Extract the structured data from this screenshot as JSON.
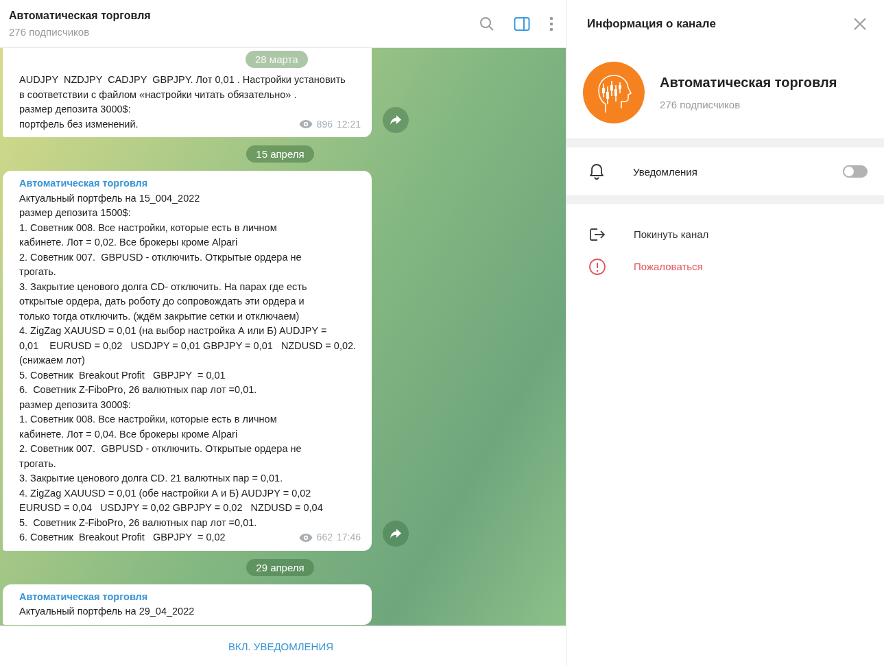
{
  "header": {
    "title": "Автоматическая торговля",
    "subtitle": "276 подписчиков",
    "actions": [
      {
        "kind": "search",
        "active": false
      },
      {
        "kind": "sidebar",
        "active": true
      },
      {
        "kind": "more",
        "active": false
      }
    ]
  },
  "chat": {
    "sticky_date": "28 марта",
    "items": [
      {
        "kind": "message",
        "lines": [
          "AUDJPY  NZDJPY  CADJPY  GBPJPY. Лот 0,01 . Настройки установить",
          "в соответствии с файлом «настройки читать обязательно» .",
          "размер депозита 3000$:",
          "портфель без изменений."
        ],
        "views": "896",
        "time": "12:21"
      },
      {
        "kind": "date",
        "text": "15 апреля"
      },
      {
        "kind": "message",
        "author": "Автоматическая торговля",
        "lines": [
          "Актуальный портфель на 15_004_2022",
          "размер депозита 1500$:",
          "1. Советник 008. Все настройки, которые есть в личном",
          "кабинете. Лот = 0,02. Все брокеры кроме Alpari",
          "2. Советник 007.  GBPUSD - отключить. Открытые ордера не",
          "трогать.",
          "3. Закрытие ценового долга CD- отключить. На парах где есть",
          "открытые ордера, дать роботу до сопровождать эти ордера и",
          "только тогда отключить. (ждём закрытие сетки и отключаем)",
          "4. ZigZag XAUUSD = 0,01 (на выбор настройка А или Б) AUDJPY =",
          "0,01    EURUSD = 0,02   USDJPY = 0,01 GBPJPY = 0,01   NZDUSD = 0,02.",
          "(снижаем лот)",
          "5. Советник  Breakout Profit   GBPJPY  = 0,01",
          "6.  Советник Z-FiboPro, 26 валютных пар лот =0,01.",
          "размер депозита 3000$:",
          "1. Советник 008. Все настройки, которые есть в личном",
          "кабинете. Лот = 0,04. Все брокеры кроме Alpari",
          "2. Советник 007.  GBPUSD - отключить. Открытые ордера не",
          "трогать.",
          "3. Закрытие ценового долга CD. 21 валютных пар = 0,01.",
          "4. ZigZag XAUUSD = 0,01 (обе настройки А и Б) AUDJPY = 0,02",
          "EURUSD = 0,04   USDJPY = 0,02 GBPJPY = 0,02   NZDUSD = 0,04",
          "5.  Советник Z-FiboPro, 26 валютных пар лот =0,01.",
          "6. Советник  Breakout Profit   GBPJPY  = 0,02"
        ],
        "views": "662",
        "time": "17:46"
      },
      {
        "kind": "date",
        "text": "29 апреля"
      },
      {
        "kind": "message",
        "author": "Автоматическая торговля",
        "lines": [
          "Актуальный портфель на 29_04_2022"
        ]
      }
    ]
  },
  "bottom_bar": {
    "button": "ВКЛ. УВЕДОМЛЕНИЯ"
  },
  "info_panel": {
    "title": "Информация о канале",
    "channel": {
      "name": "Автоматическая торговля",
      "subtitle": "276 подписчиков"
    },
    "notifications": {
      "label": "Уведомления",
      "on": false
    },
    "actions": [
      {
        "kind": "leave",
        "label": "Покинуть канал"
      },
      {
        "kind": "report",
        "label": "Пожаловаться"
      }
    ]
  }
}
